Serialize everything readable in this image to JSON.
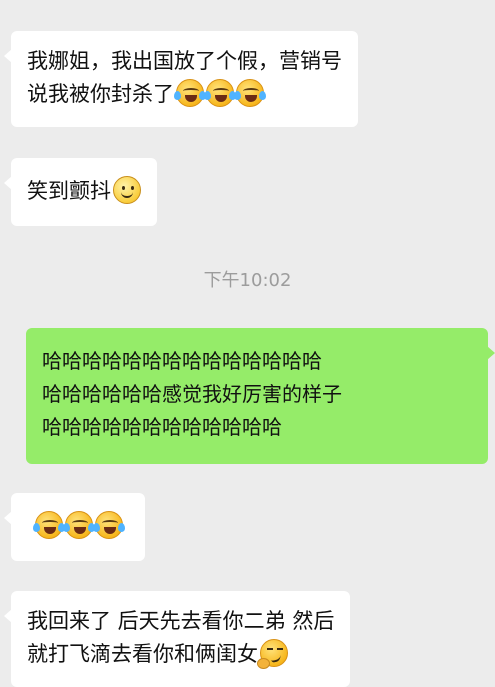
{
  "chat": {
    "messages": [
      {
        "direction": "incoming",
        "lines": [
          "我娜姐，我出国放了个假，营销号",
          "说我被你封杀了"
        ],
        "emojis": [
          "face-with-tears-of-joy-icon",
          "face-with-tears-of-joy-icon",
          "face-with-tears-of-joy-icon"
        ]
      },
      {
        "direction": "incoming",
        "lines": [
          "笑到颤抖"
        ],
        "emojis": [
          "smiling-face-icon"
        ]
      },
      {
        "direction": "outgoing",
        "lines": [
          "哈哈哈哈哈哈哈哈哈哈哈哈哈哈",
          "哈哈哈哈哈哈感觉我好厉害的样子",
          "哈哈哈哈哈哈哈哈哈哈哈哈"
        ],
        "emojis": []
      },
      {
        "direction": "incoming",
        "lines": [],
        "emojis": [
          "face-with-tears-of-joy-icon",
          "face-with-tears-of-joy-icon",
          "face-with-tears-of-joy-icon"
        ]
      },
      {
        "direction": "incoming",
        "lines": [
          "我回来了 后天先去看你二弟 然后",
          "就打飞滴去看你和俩闺女"
        ],
        "emojis": [
          "smirking-face-icon"
        ]
      }
    ],
    "timestamp": "下午10:02"
  },
  "colors": {
    "background": "#ececec",
    "incoming_bubble": "#ffffff",
    "outgoing_bubble": "#95ec69",
    "timestamp_text": "#9c9c9c"
  }
}
